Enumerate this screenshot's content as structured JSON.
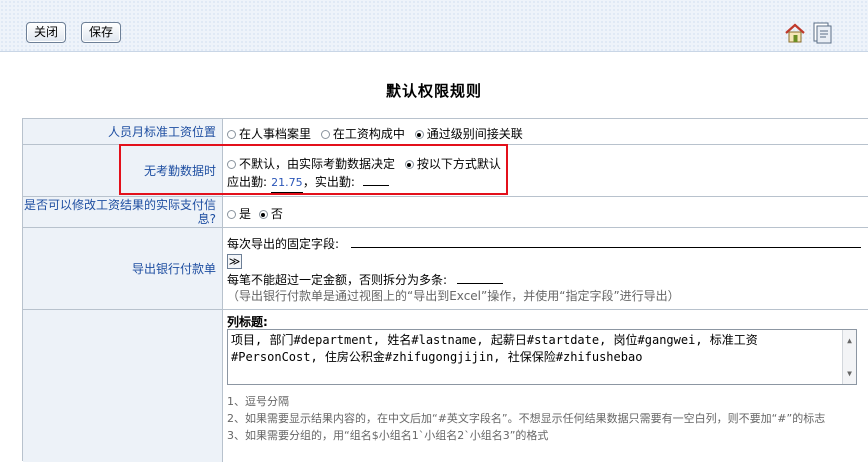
{
  "toolbar": {
    "close_label": "关闭",
    "save_label": "保存",
    "home_icon": "home-icon",
    "doc_icon": "document-icon"
  },
  "page_title": "默认权限规则",
  "rows": {
    "salary_position": {
      "label": "人员月标准工资位置",
      "options": [
        "在人事档案里",
        "在工资构成中",
        "通过级别间接关联"
      ],
      "selected": 2
    },
    "no_attendance": {
      "label": "无考勤数据时",
      "options": [
        "不默认，由实际考勤数据决定",
        "按以下方式默认"
      ],
      "selected": 1,
      "due_label": "应出勤:",
      "due_value": "21.75",
      "actual_label": "，实出勤:",
      "actual_value": ""
    },
    "modify_pay": {
      "label": "是否可以修改工资结果的实际支付信息?",
      "options": [
        "是",
        "否"
      ],
      "selected": 1
    },
    "bank_export": {
      "label": "导出银行付款单",
      "fixed_fields_label": "每次导出的固定字段:",
      "expand_button": "≫",
      "split_label": "每笔不能超过一定金额，否则拆分为多条:",
      "note": "（导出银行付款单是通过视图上的“导出到Excel”操作，并使用“指定字段”进行导出）"
    },
    "column_titles": {
      "heading": "列标题:",
      "textarea_value": "项目, 部门#department, 姓名#lastname, 起薪日#startdate, 岗位#gangwei, 标准工资#PersonCost, 住房公积金#zhifugongjijin, 社保保险#zhifushebao",
      "notes": [
        "1、逗号分隔",
        "2、如果需要显示结果内容的，在中文后加“#英文字段名”。不想显示任何结果数据只需要有一空白列，则不要加“#”的标志",
        "3、如果需要分组的，用“组名$小组名1`小组名2`小组名3”的格式"
      ]
    }
  },
  "colors": {
    "label_text": "#1e4ea1",
    "label_bg": "#edf2f8",
    "highlight": "#e3101b"
  }
}
